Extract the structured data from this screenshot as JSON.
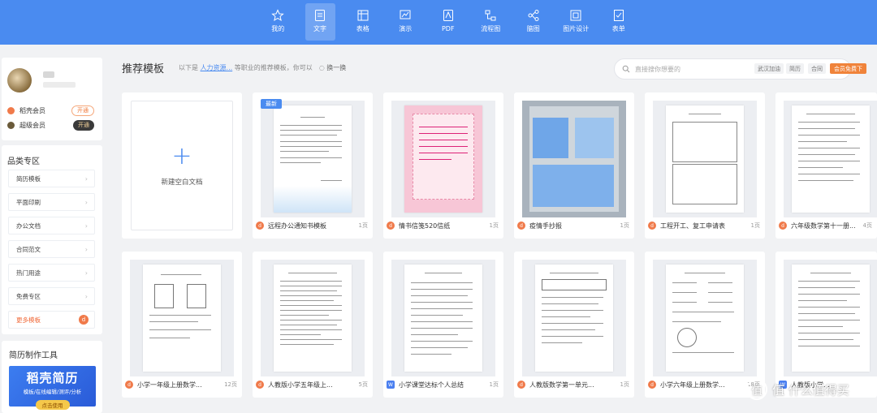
{
  "nav": {
    "items": [
      {
        "label": "我的",
        "icon": "star-icon"
      },
      {
        "label": "文字",
        "icon": "document-icon",
        "active": true
      },
      {
        "label": "表格",
        "icon": "table-icon"
      },
      {
        "label": "演示",
        "icon": "presentation-icon"
      },
      {
        "label": "PDF",
        "icon": "pdf-icon"
      },
      {
        "label": "流程图",
        "icon": "flowchart-icon"
      },
      {
        "label": "脑图",
        "icon": "mindmap-icon"
      },
      {
        "label": "图片设计",
        "icon": "image-design-icon"
      },
      {
        "label": "表单",
        "icon": "form-icon"
      }
    ]
  },
  "profile": {
    "member_1_label": "稻壳会员",
    "member_1_btn": "开通",
    "member_2_label": "超级会员",
    "member_2_btn": "开通"
  },
  "category": {
    "title": "品类专区",
    "items": [
      "简历模板",
      "平面印刷",
      "办公文档",
      "合同范文",
      "热门用途",
      "免费专区",
      "更多模板"
    ]
  },
  "resume_tool": {
    "title": "简历制作工具",
    "banner_big": "稻壳简历",
    "banner_small": "模板/在线编辑/测评/分析",
    "banner_button": "点击使用"
  },
  "main": {
    "title": "推荐模板",
    "sub_prefix": "以下是",
    "sub_link": "人力资源...",
    "sub_suffix": "等职业的推荐模板，你可以",
    "refresh": "换一换"
  },
  "search": {
    "placeholder": "直接搜你想要的",
    "tags": [
      "武汉加油",
      "简历",
      "合同"
    ],
    "vip": "会员免费下"
  },
  "new_doc": {
    "label": "新建空白文档",
    "badge": "最新"
  },
  "templates": [
    {
      "name": "远程办公通知书模板",
      "pages": "1页"
    },
    {
      "name": "情书信笺520信纸",
      "pages": "1页"
    },
    {
      "name": "疫情手抄报",
      "pages": "1页"
    },
    {
      "name": "工程开工、复工申请表",
      "pages": "1页"
    },
    {
      "name": "六年级数学第十一册...",
      "pages": "4页"
    },
    {
      "name": "小学一年级上册数学...",
      "pages": "12页"
    },
    {
      "name": "人教版小学五年级上...",
      "pages": "5页"
    },
    {
      "name": "小学课堂达标个人总结",
      "pages": "1页"
    },
    {
      "name": "人教版数学第一单元...",
      "pages": "1页"
    },
    {
      "name": "小学六年级上册数学...",
      "pages": "18页"
    },
    {
      "name": "人教版小学...",
      "pages": ""
    }
  ],
  "watermark": {
    "text": "值 什么值得买",
    "logo": "值"
  }
}
